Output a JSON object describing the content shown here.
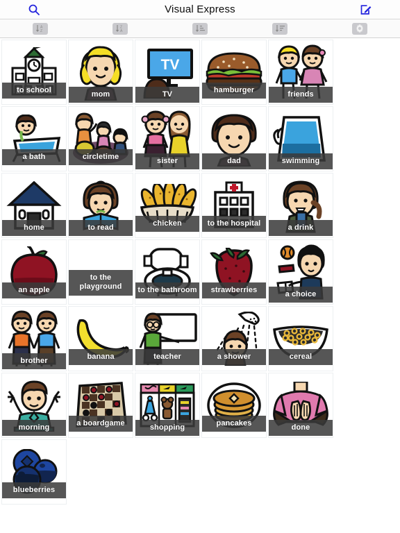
{
  "navbar": {
    "title": "Visual Express",
    "search_icon": "search-icon",
    "compose_icon": "compose-edit-icon"
  },
  "toolbar": {
    "buttons": [
      {
        "name": "sort-alpha-asc-button",
        "icon": "sort-a-to-z-icon",
        "label": "A\nZ"
      },
      {
        "name": "sort-alpha-desc-button",
        "icon": "sort-z-to-a-icon",
        "label": "Z\nA"
      },
      {
        "name": "sort-list-asc-button",
        "icon": "sort-amount-asc-icon",
        "label": ""
      },
      {
        "name": "sort-list-desc-button",
        "icon": "sort-amount-desc-icon",
        "label": ""
      },
      {
        "name": "settings-button",
        "icon": "gear-icon",
        "label": ""
      }
    ]
  },
  "colors": {
    "accent": "#2222dd",
    "caption_bg": "#3a3a3a",
    "caption_text": "#ffffff",
    "navbar_bg": "#fdfdfd",
    "toolbar_bg": "#fafafa",
    "page_bg": "#ffffff"
  },
  "grid": {
    "columns": 6,
    "item_count": 31,
    "items": [
      {
        "label": "to school",
        "art": "school",
        "cap": "cap-mid"
      },
      {
        "label": "mom",
        "art": "mom",
        "cap": "cap-low"
      },
      {
        "label": "TV",
        "art": "tv",
        "cap": "cap-low"
      },
      {
        "label": "hamburger",
        "art": "hamburger",
        "cap": "cap-mid"
      },
      {
        "label": "friends",
        "art": "friends",
        "cap": "cap-low"
      },
      {
        "label": "a bath",
        "art": "bath",
        "cap": "cap-mid"
      },
      {
        "label": "circletime",
        "art": "circletime",
        "cap": "cap-mid"
      },
      {
        "label": "sister",
        "art": "sister",
        "cap": "cap-low"
      },
      {
        "label": "dad",
        "art": "dad",
        "cap": "cap-low"
      },
      {
        "label": "swimming",
        "art": "swimming",
        "cap": "cap-low"
      },
      {
        "label": "home",
        "art": "home",
        "cap": "cap-low"
      },
      {
        "label": "to read",
        "art": "read",
        "cap": "cap-low"
      },
      {
        "label": "chicken",
        "art": "chicken",
        "cap": "cap-mid"
      },
      {
        "label": "to the hospital",
        "art": "hospital",
        "cap": "cap-mid"
      },
      {
        "label": "a drink",
        "art": "drink",
        "cap": "cap-low"
      },
      {
        "label": "an apple",
        "art": "apple",
        "cap": "cap-mid"
      },
      {
        "label": "to the playground",
        "art": "blank",
        "cap": "cap-two"
      },
      {
        "label": "to the bathroom",
        "art": "bathroom",
        "cap": "cap-mid"
      },
      {
        "label": "strawberries",
        "art": "strawberry",
        "cap": "cap-mid"
      },
      {
        "label": "a choice",
        "art": "choice",
        "cap": "cap-low"
      },
      {
        "label": "brother",
        "art": "brother",
        "cap": "cap-low"
      },
      {
        "label": "banana",
        "art": "banana",
        "cap": "cap-mid"
      },
      {
        "label": "teacher",
        "art": "teacher",
        "cap": "cap-mid"
      },
      {
        "label": "a shower",
        "art": "shower",
        "cap": "cap-mid"
      },
      {
        "label": "cereal",
        "art": "cereal",
        "cap": "cap-mid"
      },
      {
        "label": "morning",
        "art": "morning",
        "cap": "cap-low"
      },
      {
        "label": "a boardgame",
        "art": "boardgame",
        "cap": "cap-mid"
      },
      {
        "label": "shopping",
        "art": "shopping",
        "cap": "cap-low"
      },
      {
        "label": "pancakes",
        "art": "pancakes",
        "cap": "cap-mid"
      },
      {
        "label": "done",
        "art": "done",
        "cap": "cap-low"
      },
      {
        "label": "blueberries",
        "art": "blueberries",
        "cap": "cap-mid"
      }
    ]
  }
}
